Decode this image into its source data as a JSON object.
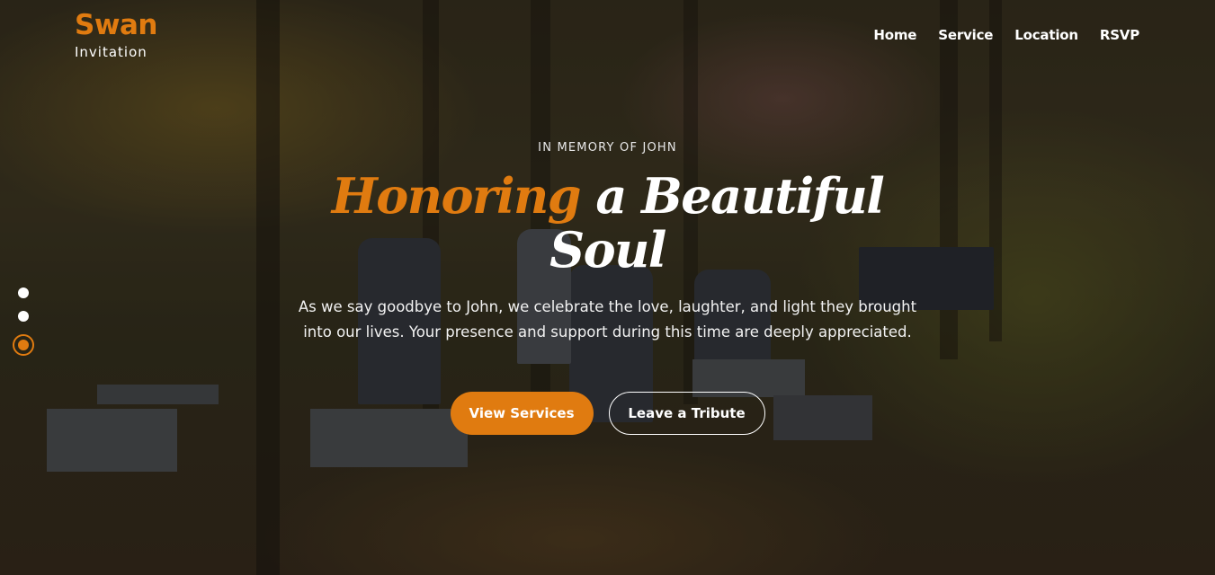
{
  "brand": {
    "name": "Swan",
    "subtitle": "Invitation"
  },
  "nav": {
    "items": [
      "Home",
      "Service",
      "Location",
      "RSVP"
    ]
  },
  "hero": {
    "eyebrow": "IN MEMORY OF JOHN",
    "title_accent": "Honoring",
    "title_rest": "a Beautiful Soul",
    "description": "As we say goodbye to John, we celebrate the love, laughter, and light they brought into our lives. Your presence and support during this time are deeply appreciated.",
    "primary_button": "View Services",
    "secondary_button": "Leave a Tribute"
  },
  "slider": {
    "total": 3,
    "active_index": 3
  },
  "colors": {
    "accent": "#e07b10",
    "text": "#ffffff"
  }
}
